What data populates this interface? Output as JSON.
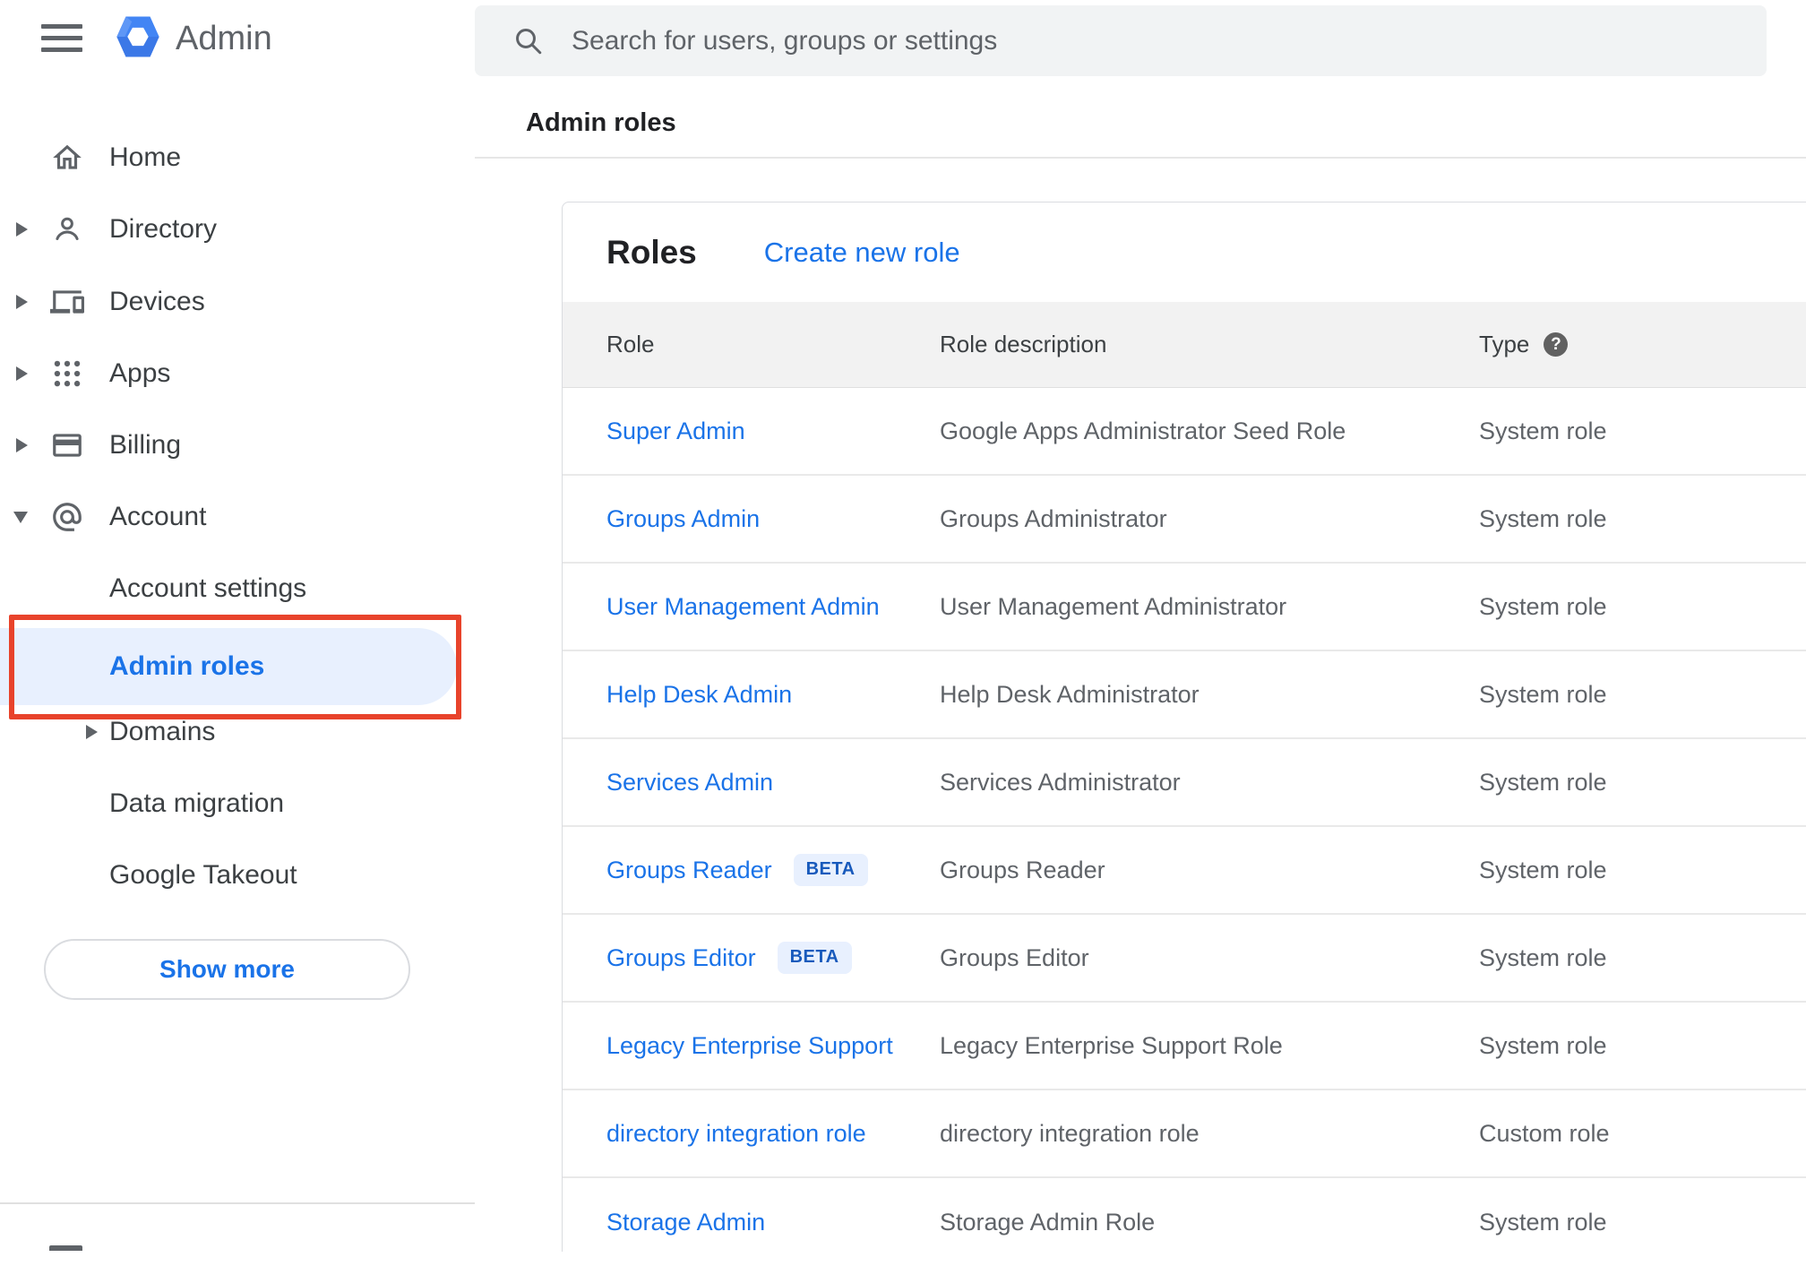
{
  "app": {
    "name": "Admin"
  },
  "search": {
    "placeholder": "Search for users, groups or settings"
  },
  "page_title": "Admin roles",
  "sidebar": {
    "items": [
      {
        "label": "Home"
      },
      {
        "label": "Directory"
      },
      {
        "label": "Devices"
      },
      {
        "label": "Apps"
      },
      {
        "label": "Billing"
      },
      {
        "label": "Account"
      },
      {
        "label": "Account settings"
      },
      {
        "label": "Admin roles"
      },
      {
        "label": "Domains"
      },
      {
        "label": "Data migration"
      },
      {
        "label": "Google Takeout"
      }
    ],
    "show_more_label": "Show more"
  },
  "content": {
    "card_title": "Roles",
    "create_link": "Create new role",
    "table": {
      "columns": [
        "Role",
        "Role description",
        "Type"
      ],
      "help_glyph": "?",
      "rows": [
        {
          "role": "Super Admin",
          "description": "Google Apps Administrator Seed Role",
          "type": "System role"
        },
        {
          "role": "Groups Admin",
          "description": "Groups Administrator",
          "type": "System role"
        },
        {
          "role": "User Management Admin",
          "description": "User Management Administrator",
          "type": "System role"
        },
        {
          "role": "Help Desk Admin",
          "description": "Help Desk Administrator",
          "type": "System role"
        },
        {
          "role": "Services Admin",
          "description": "Services Administrator",
          "type": "System role"
        },
        {
          "role": "Groups Reader",
          "beta_label": "BETA",
          "description": "Groups Reader",
          "type": "System role"
        },
        {
          "role": "Groups Editor",
          "beta_label": "BETA",
          "description": "Groups Editor",
          "type": "System role"
        },
        {
          "role": "Legacy Enterprise Support",
          "description": "Legacy Enterprise Support Role",
          "type": "System role"
        },
        {
          "role": "directory integration role",
          "description": "directory integration role",
          "type": "Custom role"
        },
        {
          "role": "Storage Admin",
          "description": "Storage Admin Role",
          "type": "System role"
        }
      ]
    }
  },
  "colors": {
    "accent_blue": "#1a73e8",
    "selected_item_bg": "#e8f0fe",
    "annotation_red": "#e8432b",
    "beta_text": "#185abc",
    "table_header_bg": "#f2f2f2",
    "search_bg": "#f1f3f4",
    "logo_blue": "#4285f4"
  }
}
